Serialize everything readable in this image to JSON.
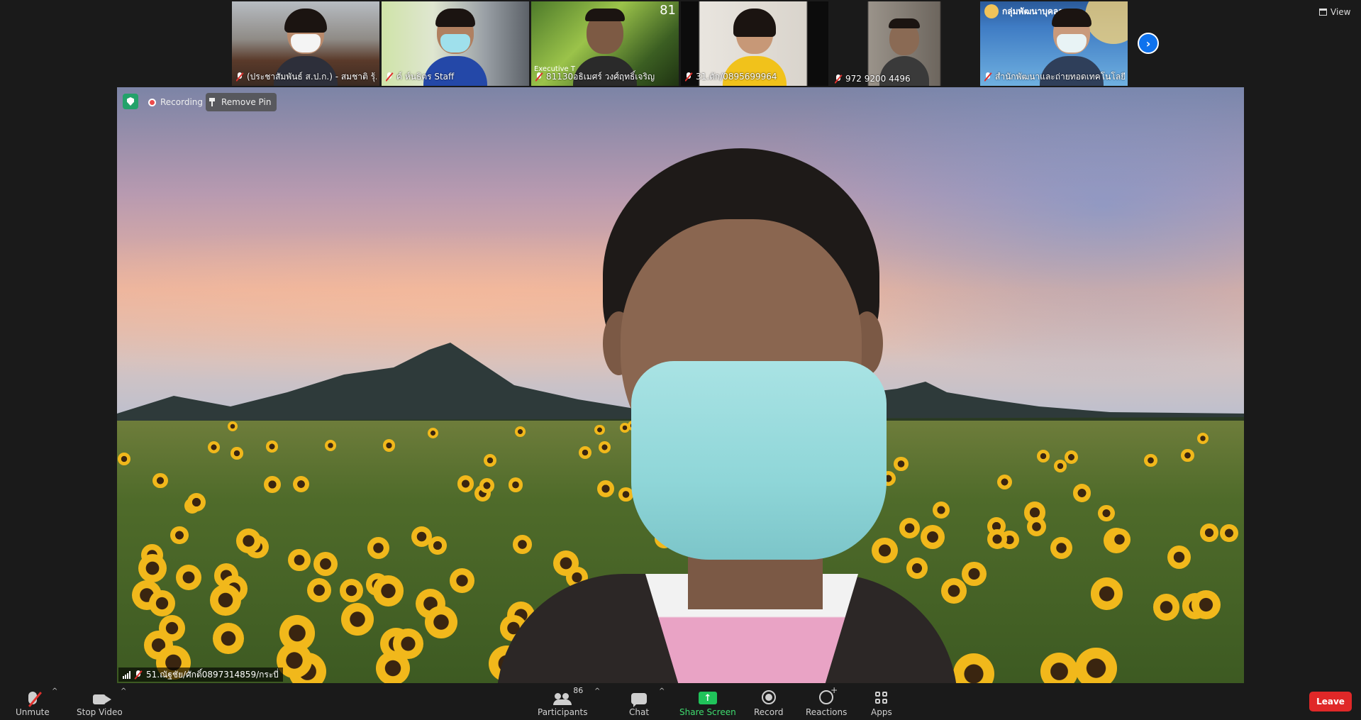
{
  "filmstrip": {
    "tiles": [
      {
        "name": "(ประชาสัมพันธ์ ส.ป.ก.) - สมชาติ รุ้...",
        "muted": true
      },
      {
        "name": "ค์ ห์นธิตร Staff",
        "muted": true
      },
      {
        "name": "81130อธิเมศร์ วงศ์ฤทธิ์เจริญ",
        "muted": true,
        "overlay_number": "81",
        "overlay_text": "Executive T"
      },
      {
        "name": "31.ตัก/0895699964",
        "muted": true
      },
      {
        "name": "972 9200 4496",
        "muted": true
      },
      {
        "name": "สำนักพัฒนาและถ่ายทอดเทคโนโลยี ...",
        "muted": true,
        "banner": "กลุ่มพัฒนาบุคลากร"
      }
    ],
    "next_label": "›"
  },
  "view_label": "View",
  "main_video": {
    "recording_label": "Recording",
    "remove_pin_label": "Remove Pin",
    "speaker_name": "51.ณัฐชัย/ศักดิ์0897314859/กระบี่"
  },
  "toolbar": {
    "unmute_label": "Unmute",
    "stop_video_label": "Stop Video",
    "participants_label": "Participants",
    "participants_count": "86",
    "chat_label": "Chat",
    "share_screen_label": "Share Screen",
    "record_label": "Record",
    "reactions_label": "Reactions",
    "apps_label": "Apps",
    "leave_label": "Leave",
    "caret": "^"
  },
  "colors": {
    "accent_blue": "#0e72ed",
    "share_green": "#20c35a",
    "leave_red": "#e02828",
    "recording_red": "#ec4b4b",
    "shield_green": "#23a26a"
  }
}
